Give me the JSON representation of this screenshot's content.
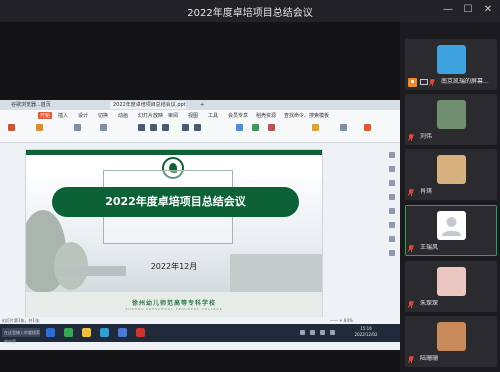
{
  "window": {
    "title": "2022年度卓培项目总结会议",
    "controls": {
      "minimize": "—",
      "maximize": "☐",
      "close": "✕"
    }
  },
  "shared_screen": {
    "tabs": [
      {
        "label": "谷歌浏览器...首页",
        "active": false
      },
      {
        "label": "2022年度卓培项目总结会议.pptx",
        "active": true
      },
      {
        "label": "+",
        "active": false
      }
    ],
    "menu": [
      "开始",
      "插入",
      "设计",
      "切换",
      "动画",
      "幻灯片放映",
      "审阅",
      "视图",
      "工具",
      "会员专享",
      "稻壳资源",
      "查找命令、搜索模板"
    ],
    "slide": {
      "title": "2022年度卓培项目总结会议",
      "date": "2022年12月",
      "school_name": "徐州幼儿师范高等专科学校",
      "school_en": "XUZHOU PRESCHOOL TEACHERS COLLEGE"
    },
    "statusbar": {
      "left": "幻灯片第1张，共1张",
      "zoom": "—— + 84%"
    },
    "taskbar": {
      "search_placeholder": "在这里输入你要搜索的内容",
      "time": "15:16",
      "date": "2022/12/02"
    }
  },
  "participants": [
    {
      "name": "南京凯瑞的屏幕...",
      "host": true,
      "muted": true,
      "avatar_color": "#3fa3e0",
      "active": false
    },
    {
      "name": "刘伟",
      "host": false,
      "muted": true,
      "avatar_color": "#6f8f6e",
      "active": false
    },
    {
      "name": "肖琪",
      "host": false,
      "muted": true,
      "avatar_color": "#d8b27e",
      "active": false
    },
    {
      "name": "王瑞风",
      "host": false,
      "muted": true,
      "avatar_color": "#ffffff",
      "active": true
    },
    {
      "name": "朱琛琛",
      "host": false,
      "muted": true,
      "avatar_color": "#e9c7c0",
      "active": false
    },
    {
      "name": "陆珊珊",
      "host": false,
      "muted": true,
      "avatar_color": "#c98a5c",
      "active": false
    }
  ]
}
